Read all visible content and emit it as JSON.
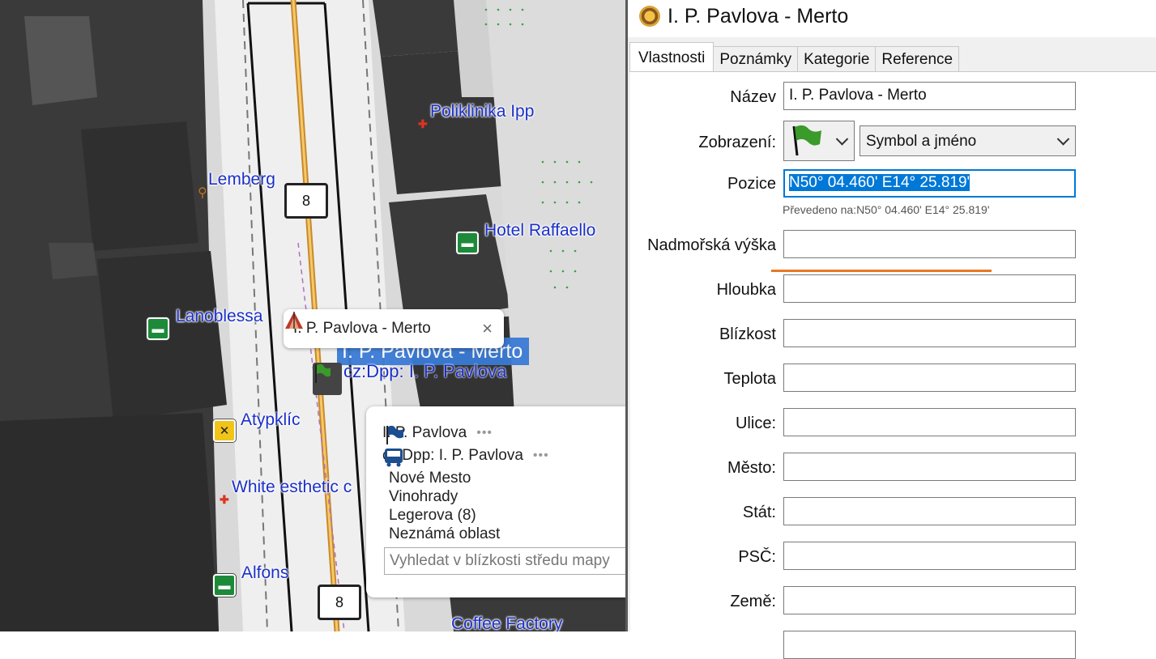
{
  "map": {
    "pois": [
      {
        "name": "Poliklinika Ipp"
      },
      {
        "name": "Lemberg"
      },
      {
        "name": "Hotel Raffaello"
      },
      {
        "name": "Lanoblessa"
      },
      {
        "name": "Atypklíc"
      },
      {
        "name": "White esthetic c"
      },
      {
        "name": "Alfons"
      },
      {
        "name": "Coffee Factory"
      }
    ],
    "route_number_top": "8",
    "route_number_bottom": "8",
    "selected_label": "I. P. Pavlova - Merto",
    "ghost_label": "cz:Dpp: I. P. Pavlova",
    "tooltip": {
      "title": "I. P. Pavlova - Merto",
      "close": "×"
    },
    "popup": {
      "rows": [
        {
          "label": "I. P. Pavlova",
          "dots": "•••"
        },
        {
          "label": "cz:Dpp: I. P. Pavlova",
          "dots": "•••"
        }
      ],
      "lines": [
        "Nové Mesto",
        "Vinohrady",
        "Legerova (8)",
        "Neznámá oblast"
      ],
      "search_placeholder": "Vyhledat v blízkosti středu mapy"
    }
  },
  "dialog": {
    "title": "I. P. Pavlova - Merto",
    "tabs": [
      "Vlastnosti",
      "Poznámky",
      "Kategorie",
      "Reference"
    ],
    "active_tab": "Vlastnosti",
    "fields": {
      "name_label": "Název",
      "name_value": "I. P. Pavlova - Merto",
      "display_label": "Zobrazení:",
      "display_value": "Symbol a jméno",
      "position_label": "Pozice",
      "position_value": "N50° 04.460' E14° 25.819'",
      "converted_text": "Převedeno na:N50° 04.460' E14° 25.819'",
      "altitude_label": "Nadmořská výška",
      "depth_label": "Hloubka",
      "proximity_label": "Blízkost",
      "temperature_label": "Teplota",
      "street_label": "Ulice:",
      "city_label": "Město:",
      "state_label": "Stát:",
      "zip_label": "PSČ:",
      "country_label": "Země:"
    },
    "colors": {
      "accent": "#0078d7",
      "underline": "#e87722",
      "flag": "#3a9a2a"
    }
  }
}
